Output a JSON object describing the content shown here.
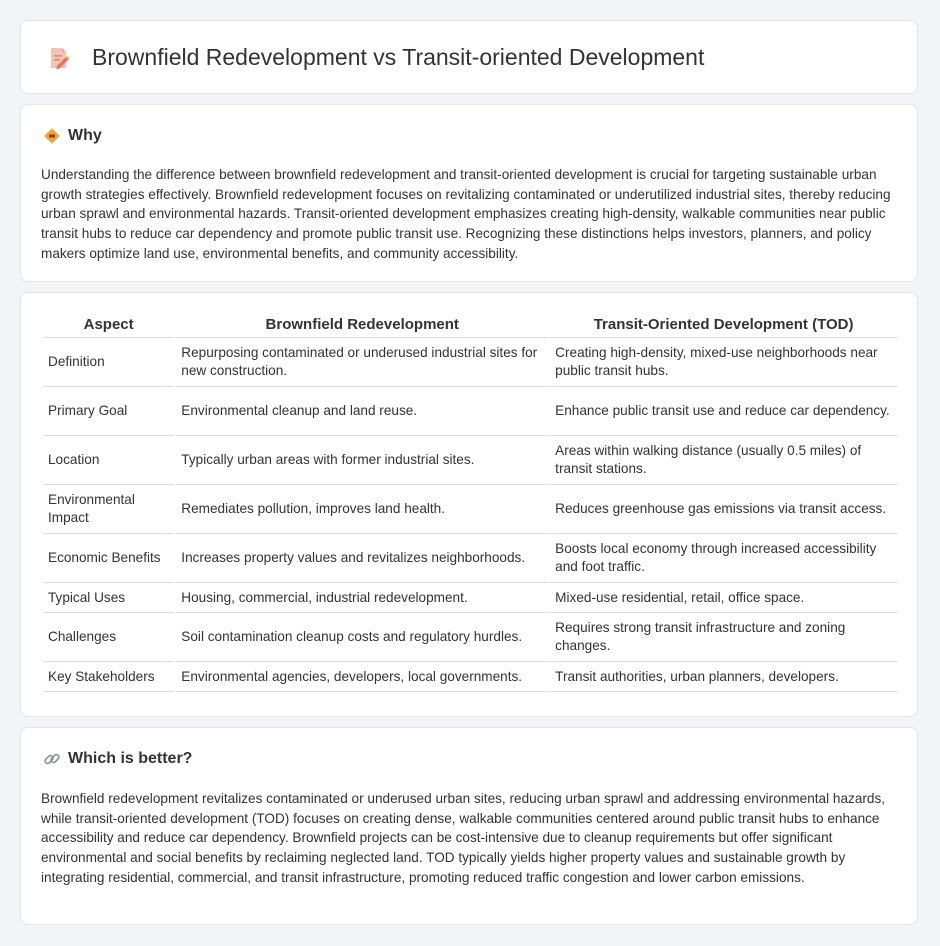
{
  "header": {
    "title": "Brownfield Redevelopment vs Transit-oriented Development",
    "icon": "document-pencil-icon"
  },
  "why": {
    "icon": "diamond-sign-icon",
    "heading": "Why",
    "text": "Understanding the difference between brownfield redevelopment and transit-oriented development is crucial for targeting sustainable urban growth strategies effectively. Brownfield redevelopment focuses on revitalizing contaminated or underutilized industrial sites, thereby reducing urban sprawl and environmental hazards. Transit-oriented development emphasizes creating high-density, walkable communities near public transit hubs to reduce car dependency and promote public transit use. Recognizing these distinctions helps investors, planners, and policy makers optimize land use, environmental benefits, and community accessibility."
  },
  "comparison": {
    "headers": [
      "Aspect",
      "Brownfield Redevelopment",
      "Transit-Oriented Development (TOD)"
    ],
    "rows": [
      [
        "Definition",
        "Repurposing contaminated or underused industrial sites for new construction.",
        "Creating high-density, mixed-use neighborhoods near public transit hubs."
      ],
      [
        "Primary Goal",
        "Environmental cleanup and land reuse.",
        "Enhance public transit use and reduce car dependency."
      ],
      [
        "Location",
        "Typically urban areas with former industrial sites.",
        "Areas within walking distance (usually 0.5 miles) of transit stations."
      ],
      [
        "Environmental Impact",
        "Remediates pollution, improves land health.",
        "Reduces greenhouse gas emissions via transit access."
      ],
      [
        "Economic Benefits",
        "Increases property values and revitalizes neighborhoods.",
        "Boosts local economy through increased accessibility and foot traffic."
      ],
      [
        "Typical Uses",
        "Housing, commercial, industrial redevelopment.",
        "Mixed-use residential, retail, office space."
      ],
      [
        "Challenges",
        "Soil contamination cleanup costs and regulatory hurdles.",
        "Requires strong transit infrastructure and zoning changes."
      ],
      [
        "Key Stakeholders",
        "Environmental agencies, developers, local governments.",
        "Transit authorities, urban planners, developers."
      ]
    ]
  },
  "better": {
    "icon": "link-icon",
    "heading": "Which is better?",
    "text": "Brownfield redevelopment revitalizes contaminated or underused urban sites, reducing urban sprawl and addressing environmental hazards, while transit-oriented development (TOD) focuses on creating dense, walkable communities centered around public transit hubs to enhance accessibility and reduce car dependency. Brownfield projects can be cost-intensive due to cleanup requirements but offer significant environmental and social benefits by reclaiming neglected land. TOD typically yields higher property values and sustainable growth by integrating residential, commercial, and transit infrastructure, promoting reduced traffic congestion and lower carbon emissions."
  }
}
